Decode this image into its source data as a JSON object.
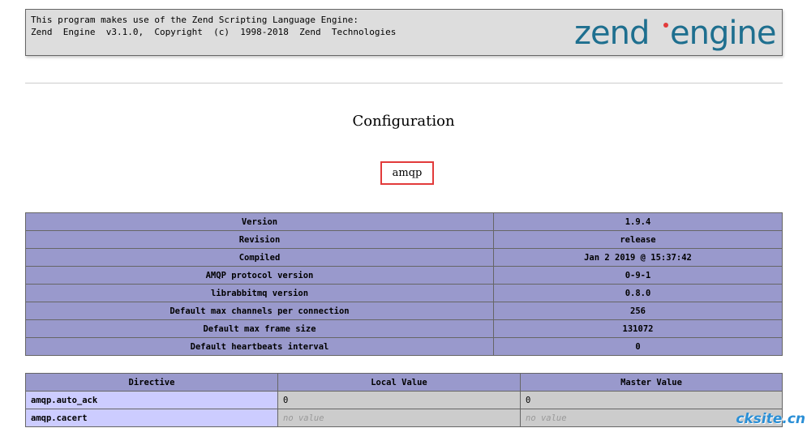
{
  "banner": {
    "line1": "This program makes use of the Zend Scripting Language Engine:",
    "line2": "Zend  Engine  v3.1.0,  Copyright  (c)  1998-2018  Zend  Technologies",
    "logo_text_zend": "zend",
    "logo_text_engine": "engine",
    "logo_color": "#1e6f8f"
  },
  "config_title": "Configuration",
  "extension_title": "amqp",
  "info_table": [
    {
      "label": "Version",
      "value": "1.9.4"
    },
    {
      "label": "Revision",
      "value": "release"
    },
    {
      "label": "Compiled",
      "value": "Jan 2 2019 @ 15:37:42"
    },
    {
      "label": "AMQP protocol version",
      "value": "0-9-1"
    },
    {
      "label": "librabbitmq version",
      "value": "0.8.0"
    },
    {
      "label": "Default max channels per connection",
      "value": "256"
    },
    {
      "label": "Default max frame size",
      "value": "131072"
    },
    {
      "label": "Default heartbeats interval",
      "value": "0"
    }
  ],
  "directive_table": {
    "headers": [
      "Directive",
      "Local Value",
      "Master Value"
    ],
    "rows": [
      {
        "directive": "amqp.auto_ack",
        "local": "0",
        "master": "0"
      },
      {
        "directive": "amqp.cacert",
        "local": "no value",
        "master": "no value"
      }
    ]
  },
  "watermark": "cksite.cn",
  "colors": {
    "header_purple": "#9999cc",
    "directive_bg": "#ccccff",
    "value_bg": "#cccccc",
    "highlight_red": "#e23b3b"
  }
}
